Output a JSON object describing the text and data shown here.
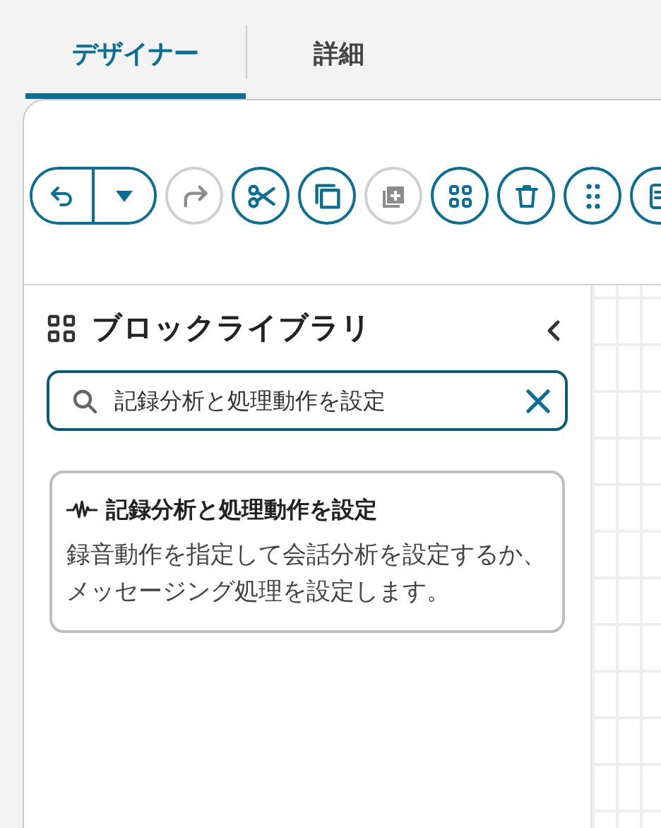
{
  "tabs": [
    {
      "label": "デザイナー",
      "selected": true
    },
    {
      "label": "詳細",
      "selected": false
    }
  ],
  "toolbar": [
    {
      "kind": "undo",
      "disabled": false
    },
    {
      "kind": "redo",
      "disabled": true
    },
    {
      "kind": "cut",
      "disabled": false
    },
    {
      "kind": "copy",
      "disabled": false
    },
    {
      "kind": "duplicate",
      "disabled": true
    },
    {
      "kind": "group",
      "disabled": false
    },
    {
      "kind": "delete",
      "disabled": false
    },
    {
      "kind": "drag",
      "disabled": false
    },
    {
      "kind": "more",
      "disabled": false
    }
  ],
  "library": {
    "title": "ブロックライブラリ",
    "search": {
      "value": "記録分析と処理動作を設定"
    },
    "results": [
      {
        "title": "記録分析と処理動作を設定",
        "description": "録音動作を指定して会話分析を設定するか、メッセージング処理を設定します。"
      }
    ]
  }
}
